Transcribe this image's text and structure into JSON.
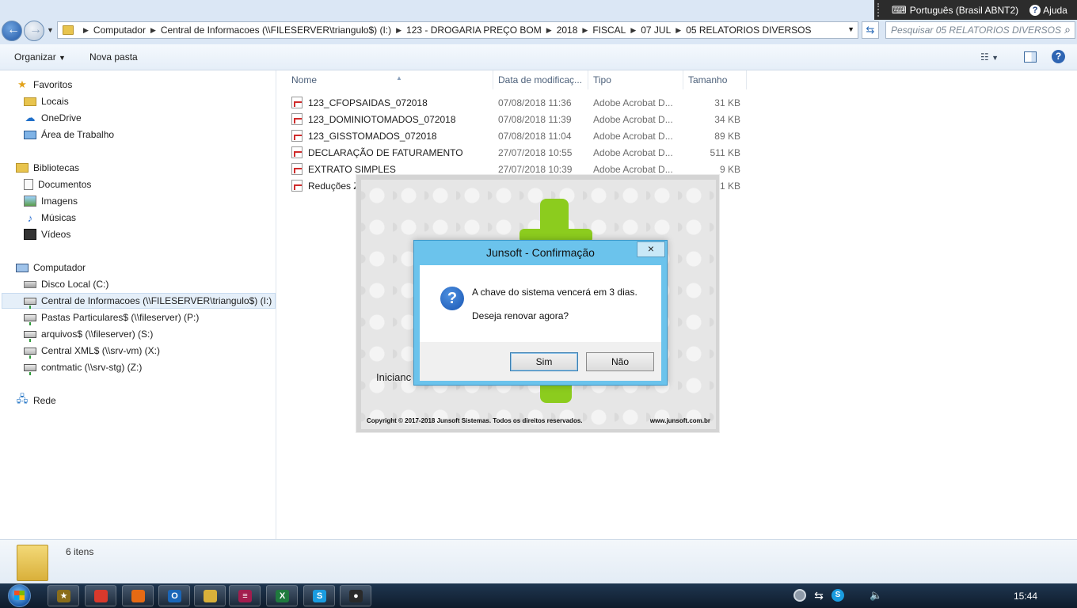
{
  "nav_buttons": {
    "back": "back",
    "forward": "forward"
  },
  "breadcrumb": [
    "Computador",
    "Central de Informacoes (\\\\FILESERVER\\triangulo$) (I:)",
    "123 - DROGARIA PREÇO BOM",
    "2018",
    "FISCAL",
    "07 JUL",
    "05 RELATORIOS DIVERSOS"
  ],
  "search": {
    "placeholder": "Pesquisar 05 RELATORIOS DIVERSOS"
  },
  "langbar": {
    "language": "Português (Brasil ABNT2)",
    "help": "Ajuda"
  },
  "commands": {
    "organize": "Organizar",
    "new_folder": "Nova pasta"
  },
  "sidebar": {
    "favorites": {
      "title": "Favoritos",
      "items": [
        "Locais",
        "OneDrive",
        "Área de Trabalho"
      ]
    },
    "libraries": {
      "title": "Bibliotecas",
      "items": [
        "Documentos",
        "Imagens",
        "Músicas",
        "Vídeos"
      ]
    },
    "computer": {
      "title": "Computador",
      "items": [
        "Disco Local (C:)",
        "Central de Informacoes (\\\\FILESERVER\\triangulo$) (I:)",
        "Pastas Particulares$ (\\\\fileserver) (P:)",
        "arquivos$ (\\\\fileserver) (S:)",
        "Central XML$ (\\\\srv-vm) (X:)",
        "contmatic (\\\\srv-stg) (Z:)"
      ]
    },
    "network": {
      "title": "Rede"
    }
  },
  "columns": {
    "name": "Nome",
    "modified": "Data de modificaç...",
    "type": "Tipo",
    "size": "Tamanho"
  },
  "files": [
    {
      "name": "123_CFOPSAIDAS_072018",
      "modified": "07/08/2018 11:36",
      "type": "Adobe Acrobat D...",
      "size": "31 KB"
    },
    {
      "name": "123_DOMINIOTOMADOS_072018",
      "modified": "07/08/2018 11:39",
      "type": "Adobe Acrobat D...",
      "size": "34 KB"
    },
    {
      "name": "123_GISSTOMADOS_072018",
      "modified": "07/08/2018 11:04",
      "type": "Adobe Acrobat D...",
      "size": "89 KB"
    },
    {
      "name": "DECLARAÇÃO DE FATURAMENTO",
      "modified": "27/07/2018 10:55",
      "type": "Adobe Acrobat D...",
      "size": "511 KB"
    },
    {
      "name": "EXTRATO SIMPLES",
      "modified": "27/07/2018 10:39",
      "type": "Adobe Acrobat D...",
      "size": "9 KB"
    },
    {
      "name": "Reduções Z",
      "modified": "",
      "type": "",
      "size": "1 KB"
    }
  ],
  "splash": {
    "loading_text": "Inicianc",
    "copyright": "Copyright © 2017-2018 Junsoft Sistemas. Todos os direitos reservados.",
    "website": "www.junsoft.com.br"
  },
  "dialog": {
    "title": "Junsoft - Confirmação",
    "close": "×",
    "message1": "A chave do sistema vencerá em 3 dias.",
    "message2": "Deseja renovar agora?",
    "yes": "Sim",
    "no": "Não"
  },
  "details": {
    "count": "6 itens"
  },
  "taskbar": {
    "apps": [
      {
        "icon": "generic-app-icon",
        "glyph": "★",
        "color": "#8a6d1a"
      },
      {
        "icon": "chrome-icon",
        "glyph": "",
        "color": "#d9392c"
      },
      {
        "icon": "firefox-icon",
        "glyph": "",
        "color": "#e66a14"
      },
      {
        "icon": "outlook-icon",
        "glyph": "O",
        "color": "#1a66b8"
      },
      {
        "icon": "file-explorer-icon",
        "glyph": "",
        "color": "#d9b03a"
      },
      {
        "icon": "notes-app-icon",
        "glyph": "≡",
        "color": "#a31d4e"
      },
      {
        "icon": "excel-icon",
        "glyph": "X",
        "color": "#1f7a3e"
      },
      {
        "icon": "skype-icon",
        "glyph": "S",
        "color": "#1a9ce0"
      },
      {
        "icon": "camera-app-icon",
        "glyph": "●",
        "color": "#2a2a2a"
      }
    ],
    "clock": "15:44"
  }
}
